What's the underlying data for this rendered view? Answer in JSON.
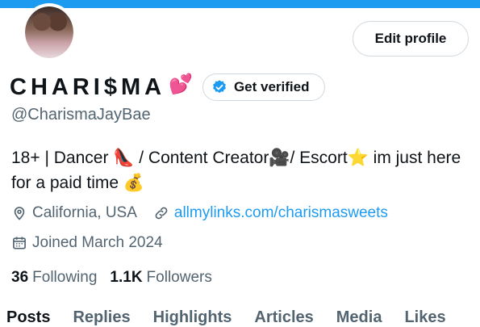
{
  "header": {
    "accent": "#1d9bf0"
  },
  "profile": {
    "display_name": "CHARI$MA",
    "name_emoji": "💕",
    "verify_label": "Get verified",
    "edit_label": "Edit profile",
    "handle": "@CharismaJayBae",
    "bio": "18+ | Dancer 👠 / Content Creator🎥/ Escort⭐️ im just here for a paid time 💰",
    "location": "California, USA",
    "link": "allmylinks.com/charismasweets",
    "joined": "Joined March 2024",
    "following_count": "36",
    "following_label": "Following",
    "followers_count": "1.1K",
    "followers_label": "Followers"
  },
  "tabs": [
    {
      "label": "Posts",
      "active": true
    },
    {
      "label": "Replies",
      "active": false
    },
    {
      "label": "Highlights",
      "active": false
    },
    {
      "label": "Articles",
      "active": false
    },
    {
      "label": "Media",
      "active": false
    },
    {
      "label": "Likes",
      "active": false
    }
  ],
  "icons": [
    "verified-badge-icon",
    "location-pin-icon",
    "link-icon",
    "calendar-icon"
  ],
  "colors": {
    "text": "#0f1419",
    "secondary": "#536471",
    "link": "#1d9bf0",
    "border": "#cfd9de"
  }
}
